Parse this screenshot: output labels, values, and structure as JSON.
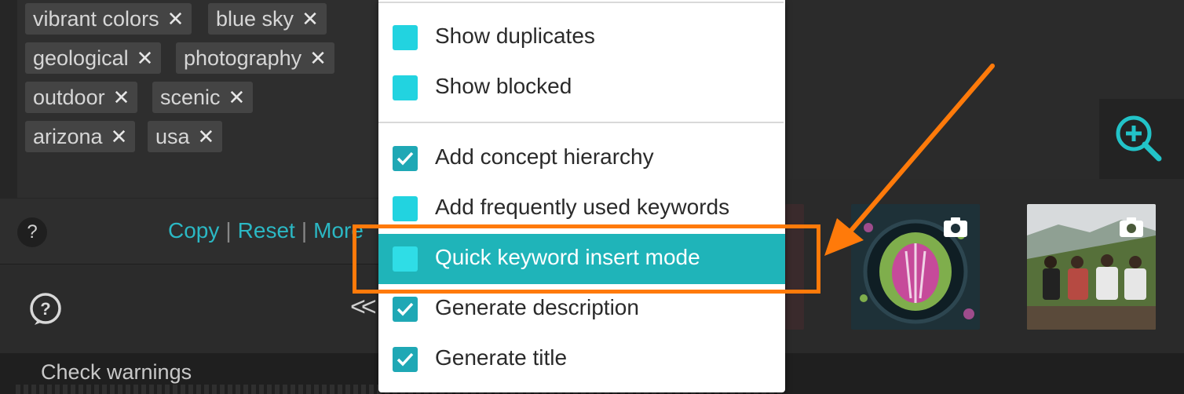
{
  "keywords": [
    {
      "label": "vibrant colors"
    },
    {
      "label": "blue sky"
    },
    {
      "label": "geological"
    },
    {
      "label": "photography"
    },
    {
      "label": "outdoor"
    },
    {
      "label": "scenic"
    },
    {
      "label": "arizona"
    },
    {
      "label": "usa"
    }
  ],
  "remove_glyph": "✕",
  "actions": {
    "help": "?",
    "copy": "Copy",
    "reset": "Reset",
    "more": "More",
    "sep": "|"
  },
  "nav": {
    "back": "<<"
  },
  "footer": {
    "check_warnings": "Check warnings"
  },
  "menu": {
    "items": [
      {
        "label": "Show duplicates",
        "checked": false
      },
      {
        "label": "Show blocked",
        "checked": false
      },
      {
        "label": "Add concept hierarchy",
        "checked": true
      },
      {
        "label": "Add frequently used keywords",
        "checked": false
      },
      {
        "label": "Quick keyword insert mode",
        "checked": false,
        "highlighted": true
      },
      {
        "label": "Generate description",
        "checked": true
      },
      {
        "label": "Generate title",
        "checked": true
      }
    ]
  },
  "colors": {
    "accent": "#22d3e0",
    "accent_dark": "#1fa8b5",
    "highlight_row": "#1fb4b9",
    "annotation": "#ff7a0a",
    "link": "#2bb8c4"
  },
  "icons": {
    "zoom": "zoom-in-icon",
    "camera": "camera-icon",
    "help": "help-circle-icon"
  }
}
